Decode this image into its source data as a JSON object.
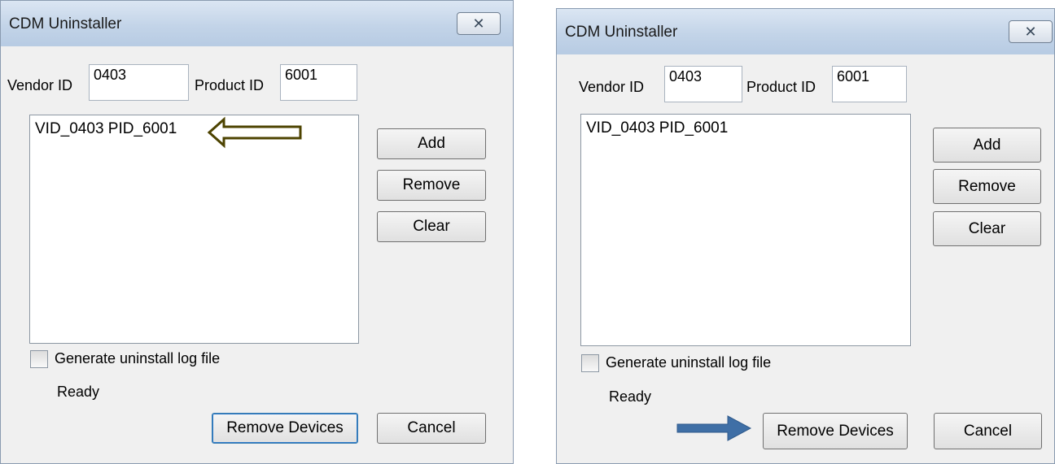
{
  "dialogs": [
    {
      "title": "CDM Uninstaller",
      "close_glyph": "✕",
      "vendor_label": "Vendor ID",
      "vendor_value": "0403",
      "product_label": "Product ID",
      "product_value": "6001",
      "list_items": [
        "VID_0403 PID_6001"
      ],
      "buttons": {
        "add": "Add",
        "remove": "Remove",
        "clear": "Clear",
        "remove_devices": "Remove Devices",
        "cancel": "Cancel"
      },
      "checkbox_label": "Generate uninstall log file",
      "checkbox_checked": false,
      "status": "Ready",
      "annotation": {
        "icon": "hollow-left-arrow",
        "target": "list-item",
        "color": "#4d4300"
      }
    },
    {
      "title": "CDM Uninstaller",
      "close_glyph": "✕",
      "vendor_label": "Vendor ID",
      "vendor_value": "0403",
      "product_label": "Product ID",
      "product_value": "6001",
      "list_items": [
        "VID_0403 PID_6001"
      ],
      "buttons": {
        "add": "Add",
        "remove": "Remove",
        "clear": "Clear",
        "remove_devices": "Remove Devices",
        "cancel": "Cancel"
      },
      "checkbox_label": "Generate uninstall log file",
      "checkbox_checked": false,
      "status": "Ready",
      "annotation": {
        "icon": "solid-right-arrow",
        "target": "remove-devices-button",
        "color": "#3f6fa6"
      }
    }
  ]
}
